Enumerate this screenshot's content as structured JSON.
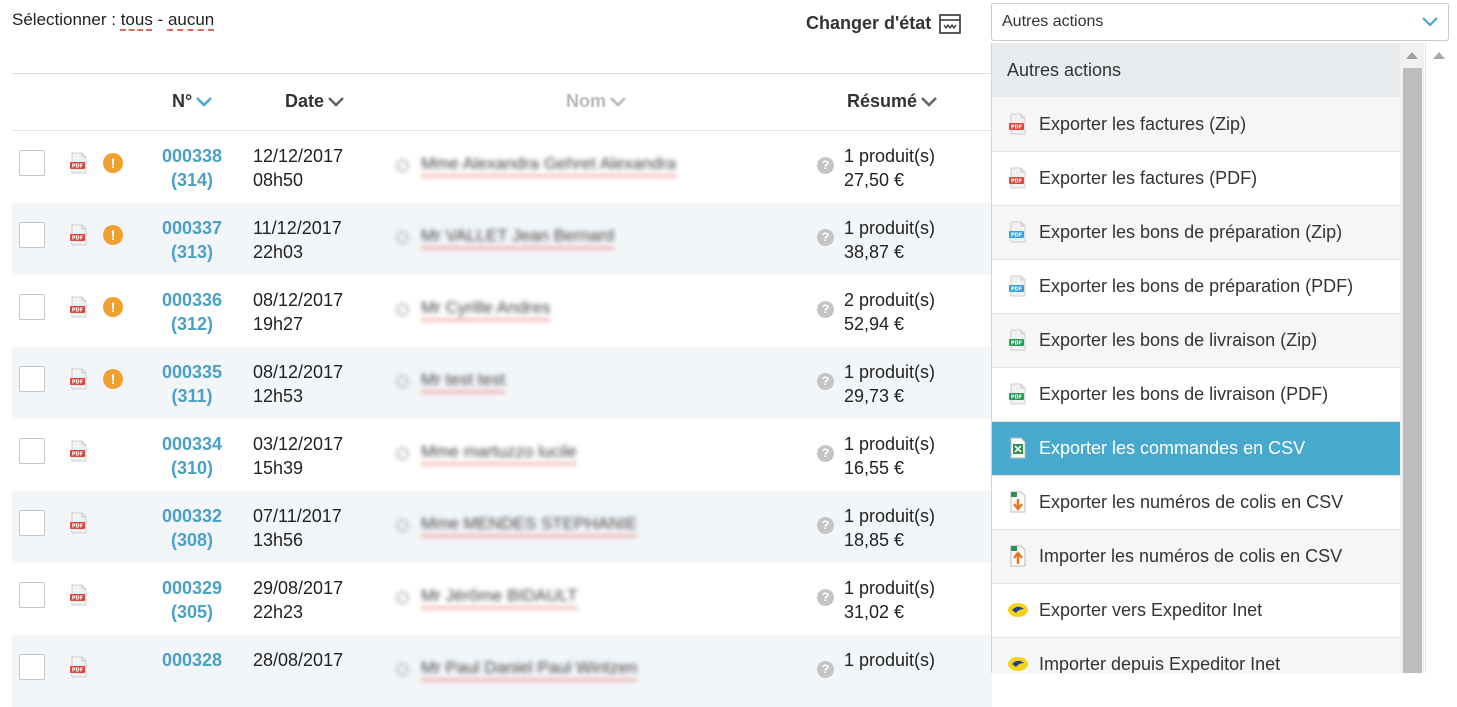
{
  "selector": {
    "label": "Sélectionner : ",
    "all": "tous",
    "dash": " - ",
    "none": "aucun"
  },
  "toolbar": {
    "change_state": "Changer d'état",
    "actions_selected": "Autres actions"
  },
  "table": {
    "columns": {
      "num": "N°",
      "date": "Date",
      "name": "Nom",
      "summary": "Résumé"
    },
    "rows": [
      {
        "num": "000338",
        "sub": "(314)",
        "date": "12/12/2017",
        "time": "08h50",
        "name": "Mme Alexandra Gehret Alexandra",
        "products": "1 produit(s)",
        "total": "27,50 €",
        "warning": true
      },
      {
        "num": "000337",
        "sub": "(313)",
        "date": "11/12/2017",
        "time": "22h03",
        "name": "Mr VALLET Jean Bernard",
        "products": "1 produit(s)",
        "total": "38,87 €",
        "warning": true
      },
      {
        "num": "000336",
        "sub": "(312)",
        "date": "08/12/2017",
        "time": "19h27",
        "name": "Mr Cyrille Andres",
        "products": "2 produit(s)",
        "total": "52,94 €",
        "warning": true
      },
      {
        "num": "000335",
        "sub": "(311)",
        "date": "08/12/2017",
        "time": "12h53",
        "name": "Mr test test",
        "products": "1 produit(s)",
        "total": "29,73 €",
        "warning": true
      },
      {
        "num": "000334",
        "sub": "(310)",
        "date": "03/12/2017",
        "time": "15h39",
        "name": "Mme martuzzo lucile",
        "products": "1 produit(s)",
        "total": "16,55 €",
        "warning": false
      },
      {
        "num": "000332",
        "sub": "(308)",
        "date": "07/11/2017",
        "time": "13h56",
        "name": "Mme MENDES STEPHANIE",
        "products": "1 produit(s)",
        "total": "18,85 €",
        "warning": false
      },
      {
        "num": "000329",
        "sub": "(305)",
        "date": "29/08/2017",
        "time": "22h23",
        "name": "Mr Jérôme BIDAULT",
        "products": "1 produit(s)",
        "total": "31,02 €",
        "warning": false
      },
      {
        "num": "000328",
        "sub": "",
        "date": "28/08/2017",
        "time": "",
        "name": "Mr Paul Daniel Paul Wintzen",
        "products": "1 produit(s)",
        "total": "",
        "warning": false
      }
    ]
  },
  "dropdown": {
    "header": "Autres actions",
    "items": [
      {
        "label": "Exporter les factures (Zip)",
        "icon": "pdf-red"
      },
      {
        "label": "Exporter les factures (PDF)",
        "icon": "pdf-red"
      },
      {
        "label": "Exporter les bons de préparation (Zip)",
        "icon": "pdf-blue"
      },
      {
        "label": "Exporter les bons de préparation (PDF)",
        "icon": "pdf-blue"
      },
      {
        "label": "Exporter les bons de livraison (Zip)",
        "icon": "pdf-green"
      },
      {
        "label": "Exporter les bons de livraison (PDF)",
        "icon": "pdf-green"
      },
      {
        "label": "Exporter les commandes en CSV",
        "icon": "csv"
      },
      {
        "label": "Exporter les numéros de colis en CSV",
        "icon": "csv-export"
      },
      {
        "label": "Importer les numéros de colis en CSV",
        "icon": "csv-import"
      },
      {
        "label": "Exporter vers Expeditor Inet",
        "icon": "laposte"
      },
      {
        "label": "Importer depuis Expeditor Inet",
        "icon": "laposte"
      }
    ],
    "active_index": 6
  },
  "colors": {
    "accent": "#48a9cf",
    "link": "#4aa0c8",
    "warning": "#f0a030"
  }
}
